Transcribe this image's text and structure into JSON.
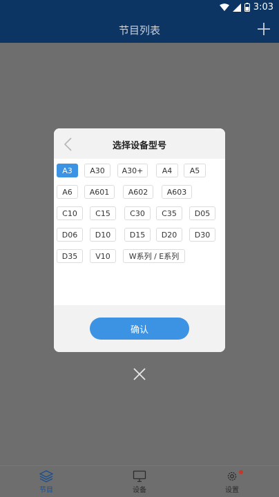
{
  "status_bar": {
    "time": "3:03"
  },
  "app_bar": {
    "title": "节目列表"
  },
  "dialog": {
    "title": "选择设备型号",
    "selected_model": "A3",
    "models": [
      "A3",
      "A30",
      "A30+",
      "A4",
      "A5",
      "A6",
      "A601",
      "A602",
      "A603",
      "C10",
      "C15",
      "C30",
      "C35",
      "D05",
      "D06",
      "D10",
      "D15",
      "D20",
      "D30",
      "D35",
      "V10",
      "W系列 / E系列"
    ],
    "confirm_label": "确认"
  },
  "bottom_nav": {
    "items": [
      {
        "label": "节目",
        "icon": "layers-icon",
        "active": true
      },
      {
        "label": "设备",
        "icon": "monitor-icon",
        "active": false
      },
      {
        "label": "设置",
        "icon": "gear-icon",
        "active": false,
        "has_badge": true
      }
    ]
  },
  "colors": {
    "header": "#0d3564",
    "accent": "#3c93e4",
    "overlay": "#6e6e6e",
    "badge": "#c0392b"
  }
}
